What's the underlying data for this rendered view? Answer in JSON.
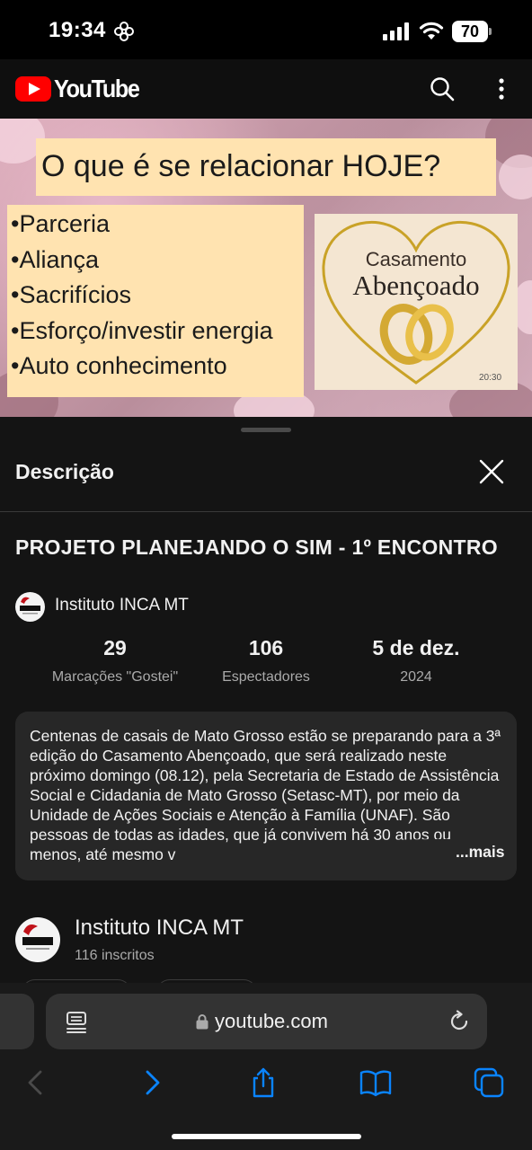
{
  "status_bar": {
    "time": "19:34",
    "battery": "70"
  },
  "header": {
    "logo_text": "YouTube"
  },
  "thumbnail": {
    "heading": "O que é se relacionar HOJE?",
    "bullets": [
      "•Parceria",
      "•Aliança",
      "•Sacrifícios",
      "•Esforço/investir energia",
      "•Auto conhecimento"
    ],
    "badge_line1": "Casamento",
    "badge_line2": "Abençoado",
    "duration": "20:30"
  },
  "description_sheet": {
    "title": "Descrição",
    "video_title": "PROJETO PLANEJANDO O SIM - 1º ENCONTRO",
    "channel_name": "Instituto INCA MT",
    "stats": [
      {
        "value": "29",
        "label": "Marcações \"Gostei\""
      },
      {
        "value": "106",
        "label": "Espectadores"
      },
      {
        "value": "5 de dez.",
        "label": "2024"
      }
    ],
    "description": "Centenas de casais de Mato Grosso estão se preparando para a 3ª edição do Casamento Abençoado, que será realizado neste próximo domingo (08.12), pela Secretaria de Estado de Assistência Social e Cidadania de Mato Grosso (Setasc-MT), por meio da Unidade de Ações Sociais e Atenção à Família (UNAF). São pessoas de todas as idades, que já convivem há 30 anos ou menos, até mesmo v",
    "more_label": "...mais",
    "channel": {
      "name": "Instituto INCA MT",
      "subscribers": "116 inscritos"
    }
  },
  "browser": {
    "url": "youtube.com"
  },
  "colors": {
    "yt_red": "#ff0000",
    "link_blue": "#0a84ff",
    "background": "#0f0f0f",
    "card": "#272727"
  }
}
